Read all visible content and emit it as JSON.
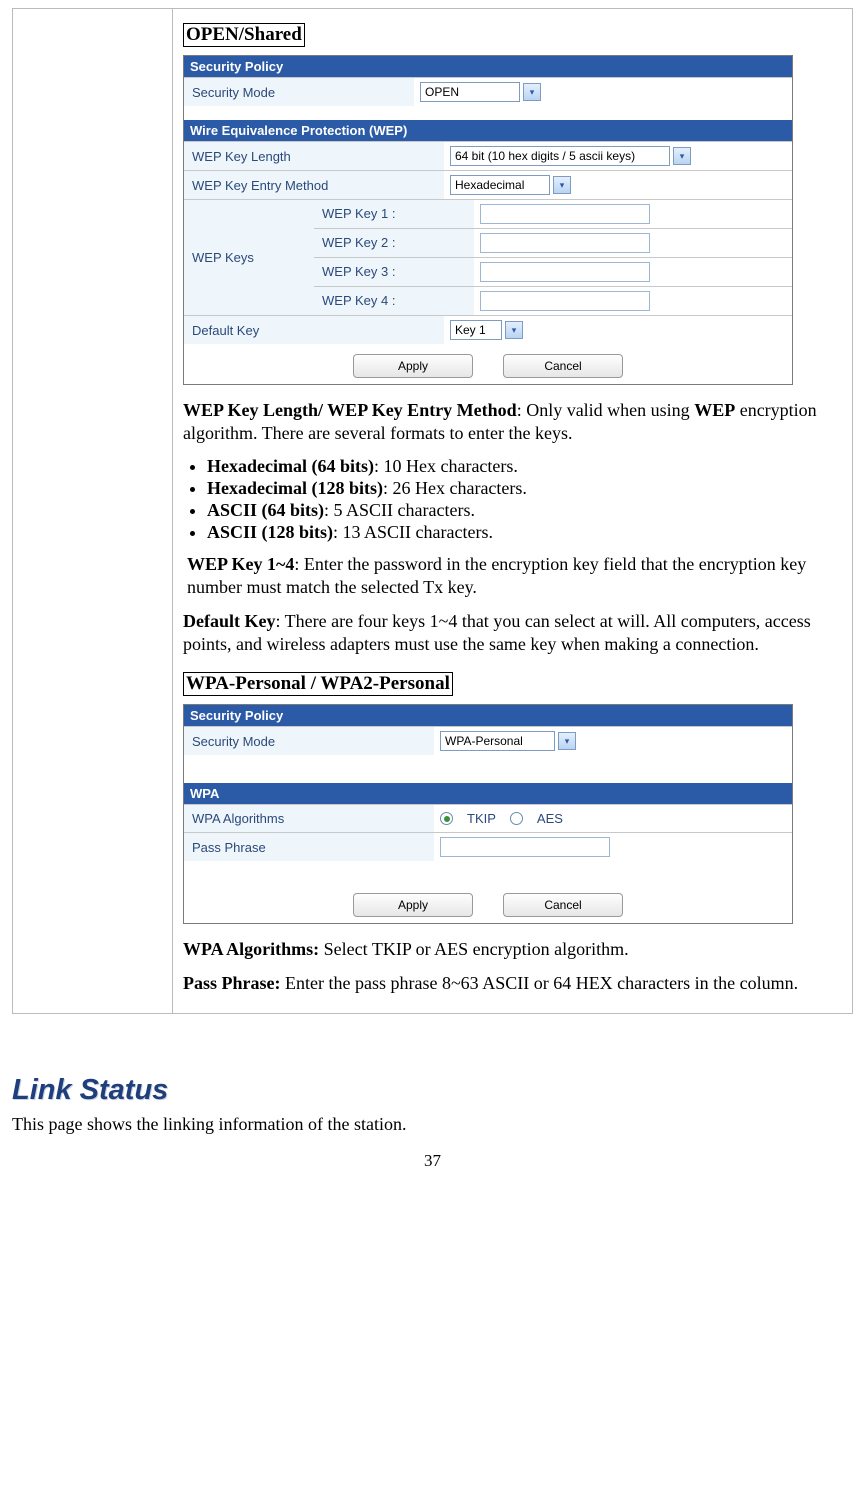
{
  "section1": {
    "title": "OPEN/Shared",
    "policyHeader": "Security Policy",
    "securityModeLabel": "Security Mode",
    "securityModeValue": "OPEN",
    "wepHeader": "Wire Equivalence Protection (WEP)",
    "wepLenLabel": "WEP Key Length",
    "wepLenValue": "64 bit (10 hex digits / 5 ascii keys)",
    "wepMethodLabel": "WEP Key Entry Method",
    "wepMethodValue": "Hexadecimal",
    "wepKeysLabel": "WEP Keys",
    "wepKey1": "WEP Key 1 :",
    "wepKey2": "WEP Key 2 :",
    "wepKey3": "WEP Key 3 :",
    "wepKey4": "WEP Key 4 :",
    "defaultKeyLabel": "Default Key",
    "defaultKeyValue": "Key 1",
    "applyBtn": "Apply",
    "cancelBtn": "Cancel"
  },
  "desc1": {
    "intro_b": "WEP Key Length/ WEP Key Entry Method",
    "intro_mid": ": Only valid when using ",
    "intro_b2": "WEP",
    "intro_rest": " encryption algorithm. There are several formats to enter the keys.",
    "li1_b": "Hexadecimal (64 bits)",
    "li1_t": ": 10 Hex characters.",
    "li2_b": "Hexadecimal (128 bits)",
    "li2_t": ": 26 Hex characters.",
    "li3_b": "ASCII (64 bits)",
    "li3_t": ": 5 ASCII characters.",
    "li4_b": "ASCII (128 bits)",
    "li4_t": ": 13 ASCII characters.",
    "wepkey_b": "WEP Key 1~4",
    "wepkey_t": ": Enter the password in the encryption key field that the encryption key number must match the selected Tx key.",
    "defkey_b": "Default Key",
    "defkey_t": ": There are four keys 1~4 that you can select at will. All computers, access points, and wireless adapters must use the same key when making a connection."
  },
  "section2": {
    "title": "WPA-Personal / WPA2-Personal",
    "policyHeader": "Security Policy",
    "securityModeLabel": "Security Mode",
    "securityModeValue": "WPA-Personal",
    "wpaHeader": "WPA",
    "algLabel": "WPA Algorithms",
    "algOpt1": "TKIP",
    "algOpt2": "AES",
    "passLabel": "Pass Phrase",
    "applyBtn": "Apply",
    "cancelBtn": "Cancel"
  },
  "desc2": {
    "alg_b": "WPA Algorithms:",
    "alg_t": " Select TKIP or AES encryption algorithm.",
    "pass_b": "Pass Phrase:",
    "pass_t": " Enter the pass phrase 8~63 ASCII or 64 HEX characters in the column."
  },
  "linkStatus": {
    "heading": "Link Status",
    "text": "This page shows the linking information of the station."
  },
  "pageNumber": "37"
}
